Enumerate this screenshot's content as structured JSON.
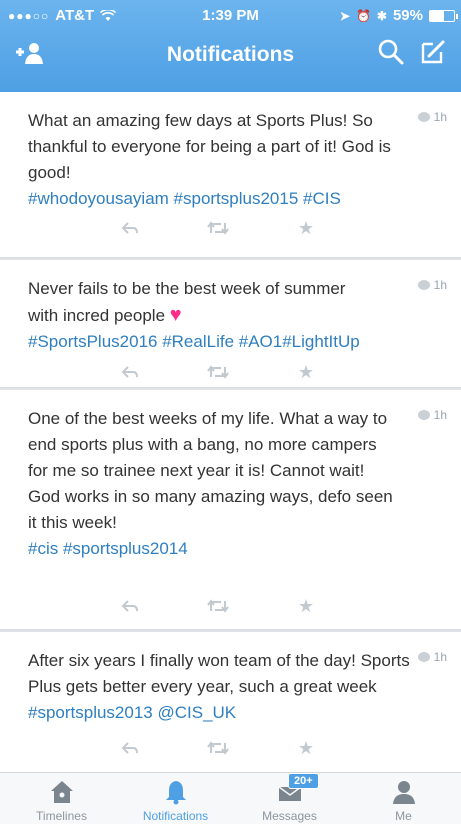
{
  "status_bar": {
    "carrier": "AT&T",
    "time": "1:39 PM",
    "battery": "59%",
    "battery_level": 0.59
  },
  "nav": {
    "title": "Notifications",
    "add_user_icon": "+👤"
  },
  "tweets": [
    {
      "text": "What an amazing few days at Sports Plus! So thankful to everyone for being a part of it! God is good!",
      "tags": "#whodoyousayiam #sportsplus2015 #CIS",
      "time": "1h"
    },
    {
      "text": "Never fails to be the best week of summer with incred people",
      "tags": "#SportsPlus2016 #RealLife #AO1#LightItUp",
      "time": "1h"
    },
    {
      "text": "One of the best weeks of my life. What a way to end sports plus with a bang, no more campers for me so trainee next year it is! Cannot wait! God works in so many amazing ways, defo seen it this week!",
      "tags": "#cis #sportsplus2014",
      "time": "1h"
    },
    {
      "text": "After six years I finally won team of the day! Sports Plus gets better every year, such a great week",
      "tags": "#sportsplus2013 @CIS_UK",
      "time": "1h"
    }
  ],
  "tabs": [
    {
      "label": "Timelines"
    },
    {
      "label": "Notifications"
    },
    {
      "label": "Messages",
      "badge": "20+"
    },
    {
      "label": "Me"
    }
  ],
  "colors": {
    "header": "#55a6e8",
    "link": "#2f7fc0",
    "heart": "#ff2d8a"
  }
}
